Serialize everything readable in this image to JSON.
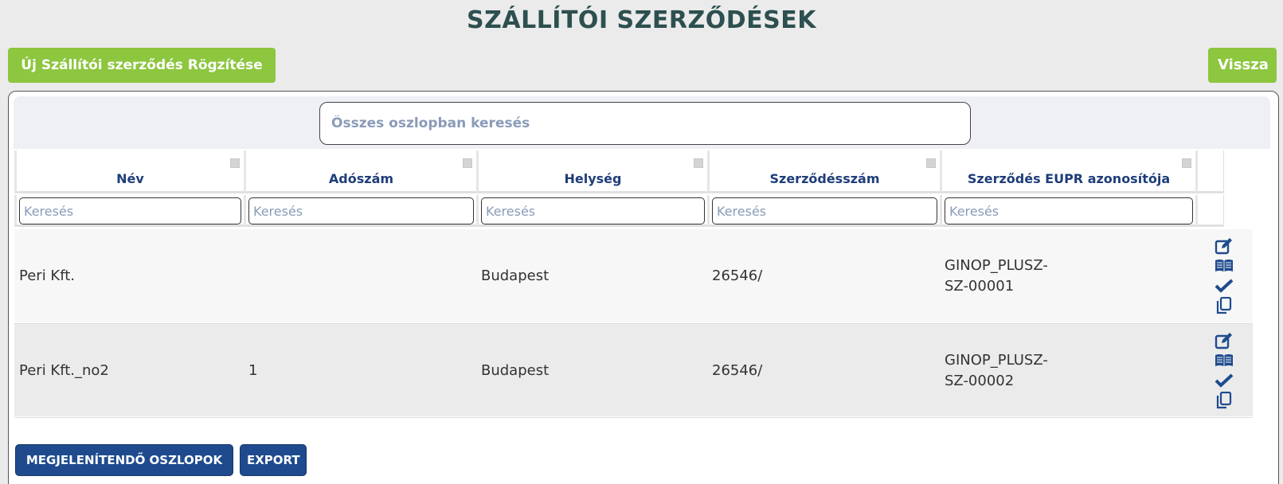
{
  "page": {
    "title": "SZÁLLÍTÓI SZERZŐDÉSEK",
    "new_button": "Új Szállítói szerződés Rögzítése",
    "back_button": "Vissza"
  },
  "search": {
    "placeholder": "Összes oszlopban keresés",
    "filter_placeholder": "Keresés"
  },
  "table": {
    "columns": [
      "Név",
      "Adószám",
      "Helység",
      "Szerződésszám",
      "Szerződés EUPR azonosítója"
    ],
    "rows": [
      {
        "nev": "Peri Kft.",
        "adoszam": "",
        "helyseg": "Budapest",
        "szerzodesszam": "26546/",
        "eupr_line1": "GINOP_PLUSZ-",
        "eupr_line2": "SZ-00001"
      },
      {
        "nev": "Peri Kft._no2",
        "adoszam": "1",
        "helyseg": "Budapest",
        "szerzodesszam": "26546/",
        "eupr_line1": "GINOP_PLUSZ-",
        "eupr_line2": "SZ-00002"
      }
    ],
    "actions": [
      "edit-icon",
      "book-icon",
      "check-icon",
      "copy-icon"
    ]
  },
  "footer": {
    "columns_button": "MEGJELENÍTENDŐ OSZLOPOK",
    "export_button": "EXPORT"
  },
  "colors": {
    "green": "#8dc63f",
    "blue": "#1f4b8e",
    "header_text": "#1e3d7a",
    "title": "#2d4f4f"
  }
}
